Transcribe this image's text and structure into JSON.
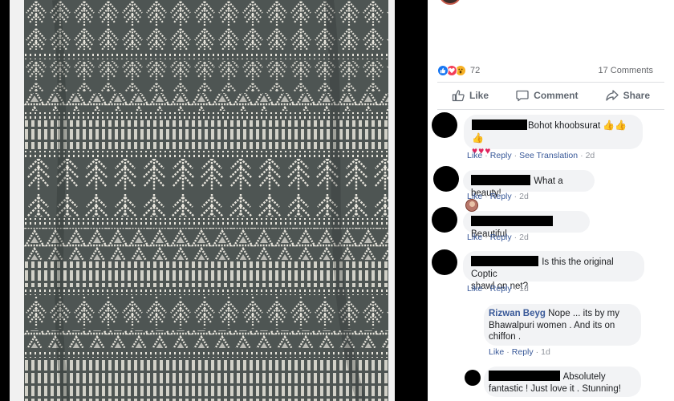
{
  "post": {
    "reactions_count": "72",
    "comments_count": "17 Comments",
    "reaction_icons": [
      "like-icon",
      "love-icon",
      "wow-icon"
    ]
  },
  "actions": {
    "like": "Like",
    "comment": "Comment",
    "share": "Share"
  },
  "comments": [
    {
      "text": "Bohot khoobsurat",
      "emoji": "👍👍👍",
      "hearts": "♥♥♥",
      "actions": [
        "Like",
        "Reply",
        "See Translation"
      ],
      "time": "2d"
    },
    {
      "text": "What a beauty!",
      "actions": [
        "Like",
        "Reply"
      ],
      "time": "2d"
    },
    {
      "text": "Beautiful",
      "actions": [
        "Like",
        "Reply"
      ],
      "time": "2d"
    },
    {
      "text_line1": "Is this the original Coptic",
      "text_line2": "shawl on net?",
      "actions": [
        "Like",
        "Reply"
      ],
      "time": "1d"
    }
  ],
  "replies": [
    {
      "author": "Rizwan Beyg",
      "text_line1": "Nope ... its by my",
      "text_line2": "Bhawalpuri women . And its on",
      "text_line3": "chiffon .",
      "actions": [
        "Like",
        "Reply"
      ],
      "time": "1d"
    },
    {
      "text_line1": "Absolutely",
      "text_line2": "fantastic ! Just love it . Stunning!"
    }
  ],
  "colors": {
    "link": "#385898",
    "bubble": "#f2f3f5",
    "muted": "#90949c",
    "like_blue": "#1877f2",
    "love_red": "#f33e58",
    "wow_yellow": "#f7b125",
    "fabric_base": "#4e5553",
    "fabric_thread": "#e9e6dd"
  }
}
